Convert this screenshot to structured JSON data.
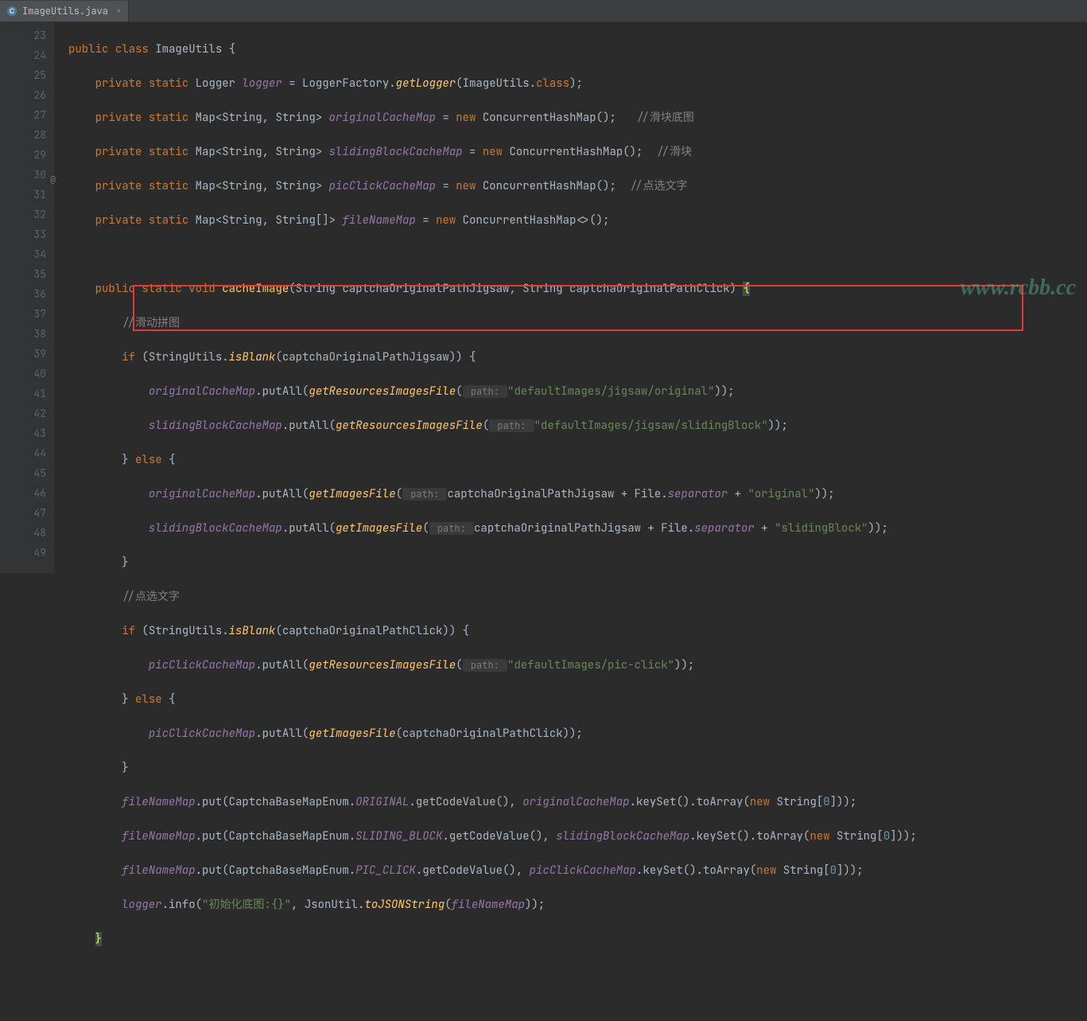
{
  "tab": {
    "filename": "ImageUtils.java",
    "close": "×"
  },
  "watermark": "www.rcbb.cc",
  "lines": {
    "start": 23,
    "end": 49,
    "l23": {
      "kw1": "public",
      "kw2": "class",
      "name": "ImageUtils",
      "br": "{"
    },
    "l24": {
      "kw1": "private",
      "kw2": "static",
      "type": "Logger",
      "field": "logger",
      "eq": " = LoggerFactory.",
      "m": "getLogger",
      "rest": "(ImageUtils.",
      "kw3": "class",
      "end": ");"
    },
    "l25": {
      "kw1": "private",
      "kw2": "static",
      "type": "Map<String, String>",
      "field": "originalCacheMap",
      "eq": " = ",
      "kw3": "new",
      "ctor": " ConcurrentHashMap();   ",
      "cmt": "//滑块底图"
    },
    "l26": {
      "kw1": "private",
      "kw2": "static",
      "type": "Map<String, String>",
      "field": "slidingBlockCacheMap",
      "eq": " = ",
      "kw3": "new",
      "ctor": " ConcurrentHashMap();  ",
      "cmt": "//滑块"
    },
    "l27": {
      "kw1": "private",
      "kw2": "static",
      "type": "Map<String, String>",
      "field": "picClickCacheMap",
      "eq": " = ",
      "kw3": "new",
      "ctor": " ConcurrentHashMap();  ",
      "cmt": "//点选文字"
    },
    "l28": {
      "kw1": "private",
      "kw2": "static",
      "type": "Map<String, String[]>",
      "field": "fileNameMap",
      "eq": " = ",
      "kw3": "new",
      "ctor": " ConcurrentHashMap<>();"
    },
    "l30": {
      "kw1": "public",
      "kw2": "static",
      "kw3": "void",
      "m": "cacheImage",
      "params": "(String captchaOriginalPathJigsaw, String captchaOriginalPathClick) ",
      "brace": "{"
    },
    "l31": {
      "cmt": "//滑动拼图"
    },
    "l32": {
      "kw": "if",
      "call": " (StringUtils.",
      "m": "isBlank",
      "rest": "(captchaOriginalPathJigsaw)) {"
    },
    "l33": {
      "field": "originalCacheMap",
      "p1": ".putAll(",
      "m": "getResourcesImagesFile",
      "p2": "(",
      "hint": " path: ",
      "str": "\"defaultImages/jigsaw/original\"",
      "end": "));"
    },
    "l34": {
      "field": "slidingBlockCacheMap",
      "p1": ".putAll(",
      "m": "getResourcesImagesFile",
      "p2": "(",
      "hint": " path: ",
      "str": "\"defaultImages/jigsaw/slidingBlock\"",
      "end": "));"
    },
    "l35": {
      "br": "} ",
      "kw": "else",
      "br2": " {"
    },
    "l36": {
      "field": "originalCacheMap",
      "p1": ".putAll(",
      "m": "getImagesFile",
      "p2": "(",
      "hint": " path: ",
      "arg": "captchaOriginalPathJigsaw + File.",
      "sep": "separator",
      "plus": " + ",
      "str": "\"original\"",
      "end": "));"
    },
    "l37": {
      "field": "slidingBlockCacheMap",
      "p1": ".putAll(",
      "m": "getImagesFile",
      "p2": "(",
      "hint": " path: ",
      "arg": "captchaOriginalPathJigsaw + File.",
      "sep": "separator",
      "plus": " + ",
      "str": "\"slidingBlock\"",
      "end": "));"
    },
    "l38": {
      "br": "}"
    },
    "l39": {
      "cmt": "//点选文字"
    },
    "l40": {
      "kw": "if",
      "call": " (StringUtils.",
      "m": "isBlank",
      "rest": "(captchaOriginalPathClick)) {"
    },
    "l41": {
      "field": "picClickCacheMap",
      "p1": ".putAll(",
      "m": "getResourcesImagesFile",
      "p2": "(",
      "hint": " path: ",
      "str": "\"defaultImages/pic-click\"",
      "end": "));"
    },
    "l42": {
      "br": "} ",
      "kw": "else",
      "br2": " {"
    },
    "l43": {
      "field": "picClickCacheMap",
      "p1": ".putAll(",
      "m": "getImagesFile",
      "rest": "(captchaOriginalPathClick));"
    },
    "l44": {
      "br": "}"
    },
    "l45": {
      "field": "fileNameMap",
      "p1": ".put(CaptchaBaseMapEnum.",
      "c": "ORIGINAL",
      "p2": ".getCodeValue(), ",
      "f2": "originalCacheMap",
      "p3": ".keySet().toArray(",
      "kw": "new",
      "p4": " String[",
      "n": "0",
      "p5": "]));"
    },
    "l46": {
      "field": "fileNameMap",
      "p1": ".put(CaptchaBaseMapEnum.",
      "c": "SLIDING_BLOCK",
      "p2": ".getCodeValue(), ",
      "f2": "slidingBlockCacheMap",
      "p3": ".keySet().toArray(",
      "kw": "new",
      "p4": " String[",
      "n": "0",
      "p5": "]));"
    },
    "l47": {
      "field": "fileNameMap",
      "p1": ".put(CaptchaBaseMapEnum.",
      "c": "PIC_CLICK",
      "p2": ".getCodeValue(), ",
      "f2": "picClickCacheMap",
      "p3": ".keySet().toArray(",
      "kw": "new",
      "p4": " String[",
      "n": "0",
      "p5": "]));"
    },
    "l48": {
      "field": "logger",
      "p1": ".info(",
      "str": "\"初始化底图:{}\"",
      "p2": ", JsonUtil.",
      "m": "toJSONString",
      "p3": "(",
      "f2": "fileNameMap",
      "end": "));"
    },
    "l49": {
      "br": "}"
    }
  }
}
